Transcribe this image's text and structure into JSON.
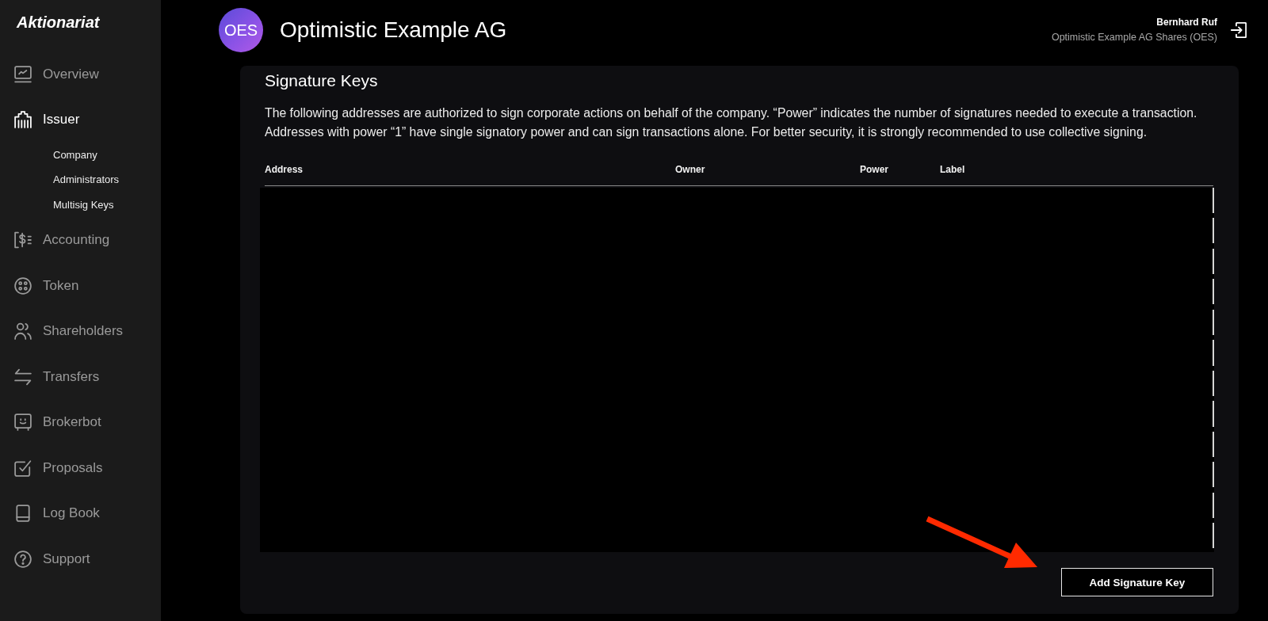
{
  "sidebar": {
    "logo": "Aktionariat",
    "items": [
      {
        "label": "Overview",
        "selected": false
      },
      {
        "label": "Issuer",
        "selected": true,
        "children": [
          {
            "label": "Company",
            "selected": false
          },
          {
            "label": "Administrators",
            "selected": false
          },
          {
            "label": "Multisig Keys",
            "selected": false
          }
        ]
      },
      {
        "label": "Accounting",
        "selected": false
      },
      {
        "label": "Token",
        "selected": false
      },
      {
        "label": "Shareholders",
        "selected": false
      },
      {
        "label": "Transfers",
        "selected": false
      },
      {
        "label": "Brokerbot",
        "selected": false
      },
      {
        "label": "Proposals",
        "selected": false
      },
      {
        "label": "Log Book",
        "selected": false
      },
      {
        "label": "Support",
        "selected": false
      }
    ]
  },
  "header": {
    "avatar": "OES",
    "title": "Optimistic Example AG",
    "user": {
      "name": "Bernhard Ruf",
      "account": "Optimistic Example AG Shares (OES)"
    }
  },
  "panel": {
    "title": "Signature Keys",
    "description": "The following addresses are authorized to sign corporate actions on behalf of the company. “Power” indicates the number of signatures needed to execute a transaction. Addresses with power “1” have single signatory power and can sign transactions alone. For better security, it is strongly recommended to use collective signing.",
    "table": {
      "columns": [
        "Address",
        "Owner",
        "Power",
        "Label"
      ]
    },
    "button": "Add Signature Key"
  }
}
